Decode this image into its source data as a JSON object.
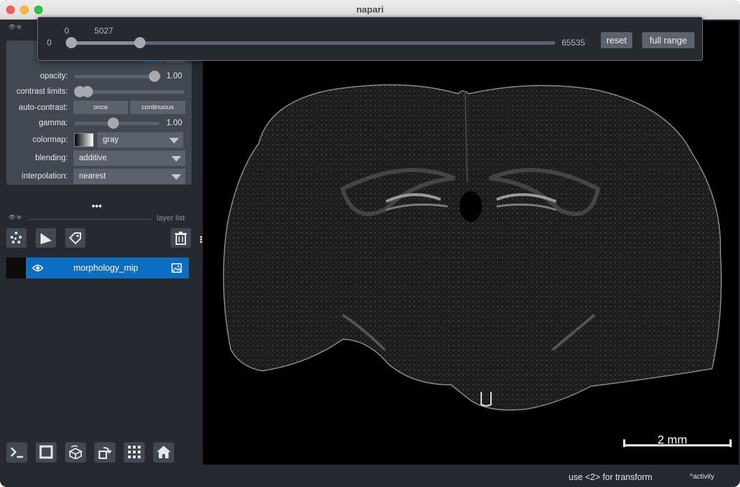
{
  "window": {
    "title": "napari"
  },
  "controls": {
    "opacity_label": "opacity:",
    "opacity_value": "1.00",
    "contrast_label": "contrast limits:",
    "auto_contrast_label": "auto-contrast:",
    "auto_once": "once",
    "auto_continuous": "continuous",
    "gamma_label": "gamma:",
    "gamma_value": "1.00",
    "colormap_label": "colormap:",
    "colormap_value": "gray",
    "blending_label": "blending:",
    "blending_value": "additive",
    "interpolation_label": "interpolation:",
    "interpolation_value": "nearest",
    "opacity_level": 1.0,
    "gamma_level": 1.0
  },
  "layer_list": {
    "title": "layer list",
    "layers": [
      {
        "name": "morphology_mip",
        "visible": true,
        "type_icon": "image-icon"
      }
    ]
  },
  "contrast_popup": {
    "min_label": "0",
    "max_label": "65535",
    "low_value": "0",
    "high_value": "5027",
    "low": 0,
    "high": 5027,
    "range_max": 65535,
    "reset_label": "reset",
    "full_range_label": "full range"
  },
  "canvas": {
    "scale_bar_label": "2 mm"
  },
  "status": {
    "message": "use <2> for transform",
    "activity_label": "activity"
  },
  "colors": {
    "panel_bg": "#262930",
    "control_bg": "#414851",
    "accent": "#0a6fc2"
  }
}
